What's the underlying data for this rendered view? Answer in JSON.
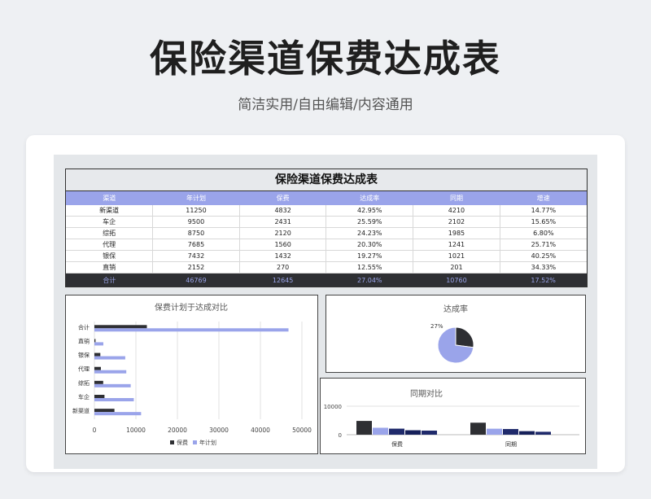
{
  "header": {
    "title": "保险渠道保费达成表",
    "subtitle": "简洁实用/自由编辑/内容通用"
  },
  "table": {
    "title": "保险渠道保费达成表",
    "columns": [
      "渠道",
      "年计划",
      "保费",
      "达成率",
      "同期",
      "增速"
    ],
    "rows": [
      [
        "新渠道",
        "11250",
        "4832",
        "42.95%",
        "4210",
        "14.77%"
      ],
      [
        "车企",
        "9500",
        "2431",
        "25.59%",
        "2102",
        "15.65%"
      ],
      [
        "综拓",
        "8750",
        "2120",
        "24.23%",
        "1985",
        "6.80%"
      ],
      [
        "代理",
        "7685",
        "1560",
        "20.30%",
        "1241",
        "25.71%"
      ],
      [
        "银保",
        "7432",
        "1432",
        "19.27%",
        "1021",
        "40.25%"
      ],
      [
        "直销",
        "2152",
        "270",
        "12.55%",
        "201",
        "34.33%"
      ]
    ],
    "total": [
      "合计",
      "46769",
      "12645",
      "27.04%",
      "10760",
      "17.52%"
    ]
  },
  "colors": {
    "dark": "#2e2f33",
    "accent": "#9aa4ea",
    "navy": "#1f2a6b",
    "navy2": "#16205a"
  },
  "chart_data": [
    {
      "type": "bar",
      "orientation": "horizontal",
      "title": "保费计划于达成对比",
      "categories": [
        "合计",
        "直销",
        "银保",
        "代理",
        "综拓",
        "车企",
        "新渠道"
      ],
      "series": [
        {
          "name": "保费",
          "values": [
            12645,
            270,
            1432,
            1560,
            2120,
            2431,
            4832
          ]
        },
        {
          "name": "年计划",
          "values": [
            46769,
            2152,
            7432,
            7685,
            8750,
            9500,
            11250
          ]
        }
      ],
      "xlim": [
        0,
        50000
      ],
      "xticks": [
        "0",
        "10000",
        "20000",
        "30000",
        "40000",
        "50000"
      ],
      "grid": true,
      "legend": "bottom"
    },
    {
      "type": "pie",
      "title": "达成率",
      "values": [
        27.04,
        72.96
      ],
      "label": "27%"
    },
    {
      "type": "bar",
      "title": "同期对比",
      "categories": [
        "保费",
        "同期"
      ],
      "ylim": [
        0,
        10000
      ],
      "yticks": [
        "10000",
        "0"
      ],
      "values": [
        [
          4832,
          2431,
          2120,
          1560,
          1432
        ],
        [
          4210,
          2102,
          1985,
          1241,
          1021
        ]
      ]
    }
  ]
}
